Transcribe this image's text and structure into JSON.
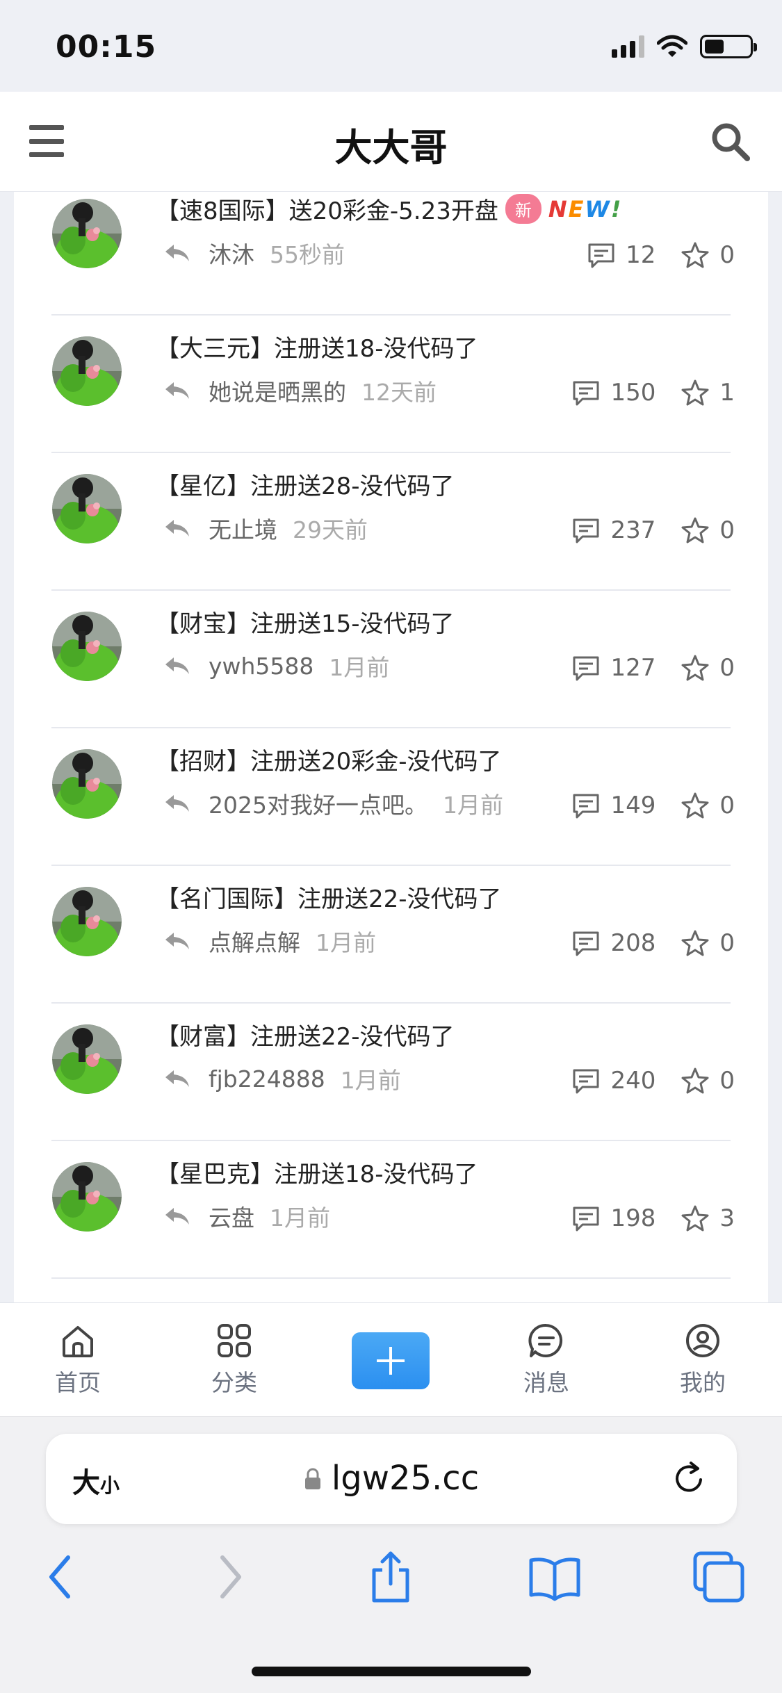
{
  "status": {
    "time": "00:15"
  },
  "header": {
    "title": "大大哥",
    "menu_icon": "hamburger-menu-icon",
    "search_icon": "search-icon"
  },
  "posts": [
    {
      "title": "【速8国际】送20彩金-5.23开盘",
      "badge": "新",
      "new_tag": "NEW!",
      "reply_author": "沐沐",
      "reply_time": "55秒前",
      "comments": "12",
      "favorites": "0"
    },
    {
      "title": "【大三元】注册送18-没代码了",
      "reply_author": "她说是晒黑的",
      "reply_time": "12天前",
      "comments": "150",
      "favorites": "1"
    },
    {
      "title": "【星亿】注册送28-没代码了",
      "reply_author": "无止境",
      "reply_time": "29天前",
      "comments": "237",
      "favorites": "0"
    },
    {
      "title": "【财宝】注册送15-没代码了",
      "reply_author": "ywh5588",
      "reply_time": "1月前",
      "comments": "127",
      "favorites": "0"
    },
    {
      "title": "【招财】注册送20彩金-没代码了",
      "reply_author": "2025对我好一点吧。",
      "reply_time": "1月前",
      "comments": "149",
      "favorites": "0"
    },
    {
      "title": "【名门国际】注册送22-没代码了",
      "reply_author": "点解点解",
      "reply_time": "1月前",
      "comments": "208",
      "favorites": "0"
    },
    {
      "title": "【财富】注册送22-没代码了",
      "reply_author": "fjb224888",
      "reply_time": "1月前",
      "comments": "240",
      "favorites": "0"
    },
    {
      "title": "【星巴克】注册送18-没代码了",
      "reply_author": "云盘",
      "reply_time": "1月前",
      "comments": "198",
      "favorites": "3"
    }
  ],
  "tabbar": {
    "home": "首页",
    "category": "分类",
    "add_icon": "plus-icon",
    "messages": "消息",
    "mine": "我的"
  },
  "safari": {
    "text_size_big": "大",
    "text_size_small": "小",
    "url": "lgw25.cc"
  },
  "colors": {
    "accent": "#2b8ff0",
    "badge": "#f47b94",
    "muted": "#666666"
  }
}
